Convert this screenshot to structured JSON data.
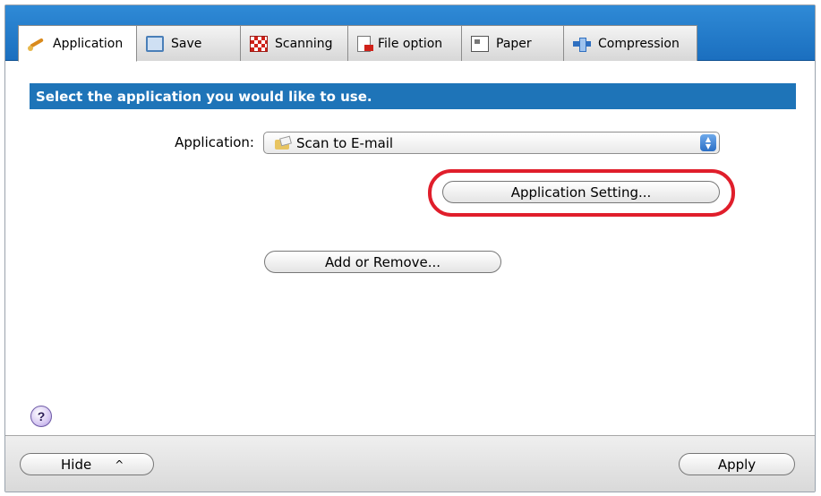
{
  "tabs": [
    {
      "label": "Application",
      "icon": "application-icon",
      "active": true
    },
    {
      "label": "Save",
      "icon": "save-icon",
      "active": false
    },
    {
      "label": "Scanning",
      "icon": "scanning-icon",
      "active": false
    },
    {
      "label": "File option",
      "icon": "file-option-icon",
      "active": false
    },
    {
      "label": "Paper",
      "icon": "paper-icon",
      "active": false
    },
    {
      "label": "Compression",
      "icon": "compression-icon",
      "active": false
    }
  ],
  "section": {
    "header": "Select the application you would like to use."
  },
  "application": {
    "label": "Application:",
    "selected": "Scan to E-mail",
    "icon": "folder-icon"
  },
  "buttons": {
    "application_setting": "Application Setting...",
    "add_remove": "Add or Remove...",
    "hide": "Hide",
    "hide_caret": "^",
    "apply": "Apply",
    "help": "?"
  },
  "colors": {
    "tabbar": "#1b6fbf",
    "section_header": "#1e74b8",
    "highlight": "#e01e2b"
  }
}
